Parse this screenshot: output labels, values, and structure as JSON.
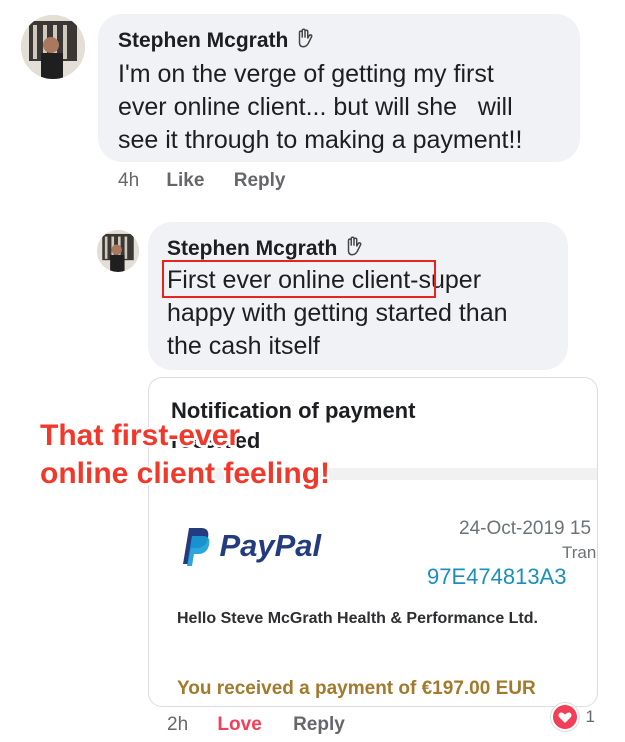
{
  "comment1": {
    "author": "Stephen Mcgrath",
    "text_lines": [
      "I'm on the verge of getting my first",
      "ever online client... but will she   will",
      "see it through to making a payment!!"
    ],
    "time": "4h",
    "like_label": "Like",
    "reply_label": "Reply"
  },
  "comment2": {
    "author": "Stephen Mcgrath",
    "highlight_text": "First ever online client",
    "text_line1_rest": "-super",
    "text_lines": [
      "happy with getting started than",
      "the cash itself"
    ],
    "time": "2h",
    "love_label": "Love",
    "reply_label": "Reply",
    "reaction_count": "1"
  },
  "attachment": {
    "heading_line1": "Notification of payment",
    "heading_line2": "received",
    "paypal_brand": "PayPal",
    "date": "24-Oct-2019 15",
    "tran_label": "Tran",
    "transaction_id": "97E474813A3",
    "greeting": "Hello Steve McGrath Health & Performance Ltd.",
    "payment_text": "You received a payment of €197.00 EUR"
  },
  "overlay": {
    "line1": "That first-ever",
    "line2": "online client feeling!"
  },
  "colors": {
    "highlight_box": "#e8241c",
    "overlay_text": "#f0392b",
    "love": "#f33e58",
    "paypal_dark": "#253b80",
    "paypal_light": "#179bd7",
    "payment_text": "#a37a2c"
  }
}
